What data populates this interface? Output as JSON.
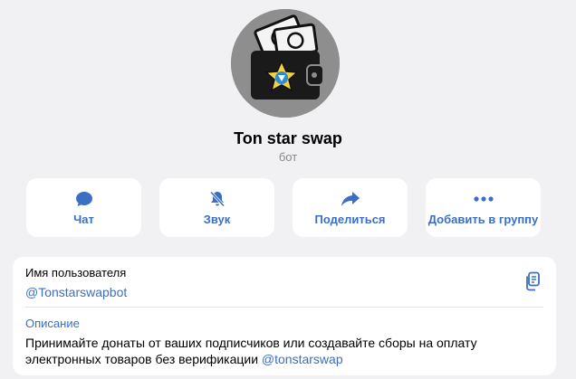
{
  "profile": {
    "name": "Ton star swap",
    "type_label": "бот",
    "avatar_icon": "wallet-star-icon"
  },
  "actions": [
    {
      "label": "Чат",
      "icon": "chat-bubble-icon"
    },
    {
      "label": "Звук",
      "icon": "bell-muted-icon"
    },
    {
      "label": "Поделиться",
      "icon": "share-arrow-icon"
    },
    {
      "label": "Добавить в группу",
      "icon": "more-dots-icon"
    }
  ],
  "info": {
    "username_label": "Имя пользователя",
    "username_value": "@Tonstarswapbot",
    "copy_icon": "copy-icon",
    "description_label": "Описание",
    "description_text": "Принимайте донаты от ваших подписчиков или создавайте сборы на оплату электронных товаров без верификации",
    "description_link": "@tonstarswap"
  },
  "colors": {
    "accent": "#3a6fc4",
    "background": "#f1f1f4",
    "card": "#ffffff",
    "muted": "#8a8a8e"
  }
}
